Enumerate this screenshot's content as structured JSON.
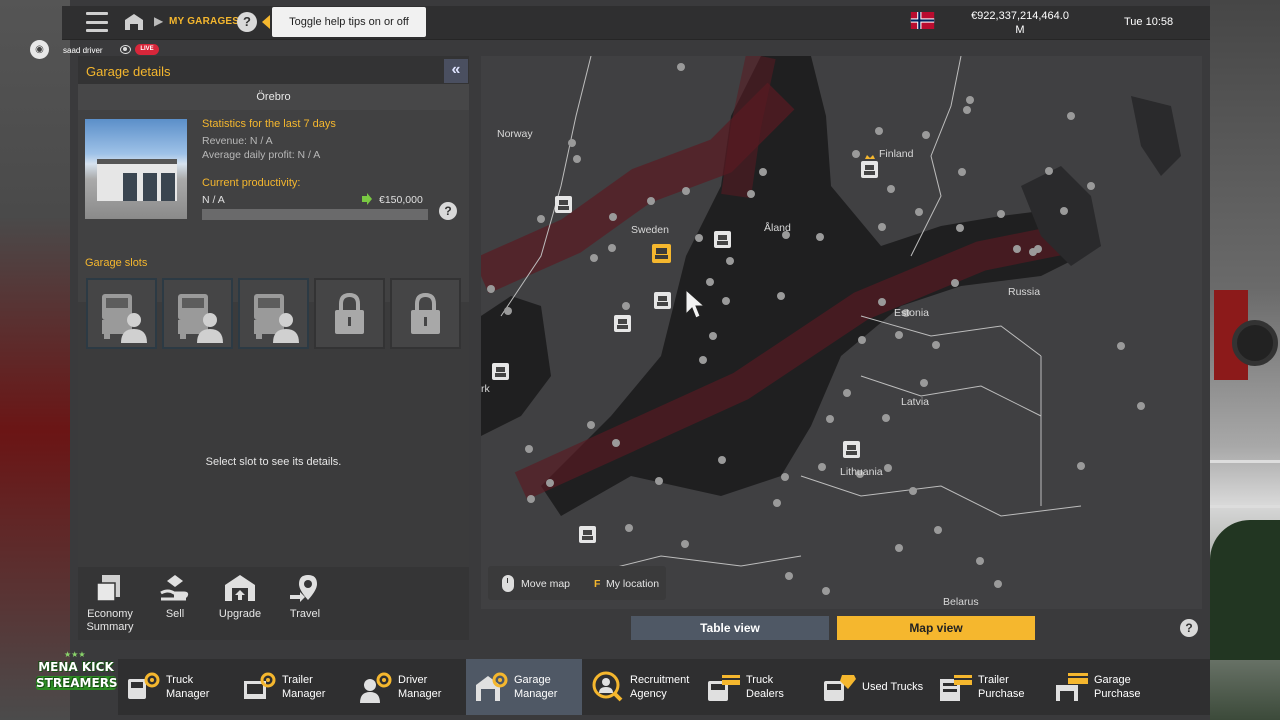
{
  "topbar": {
    "breadcrumb": "MY GARAGES",
    "help_glyph": "?",
    "tooltip": "Toggle help tips on or off",
    "money_line1": "€922,337,214,464.0",
    "money_line2": "M",
    "time": "Tue 10:58",
    "flag": "norway-flag"
  },
  "stream": {
    "user": "saad driver",
    "live": "LIVE"
  },
  "panel": {
    "title": "Garage details",
    "collapse_glyph": "«",
    "city": "Örebro",
    "stats_title": "Statistics for the last 7 days",
    "revenue": "Revenue: N / A",
    "avg_profit": "Average daily profit: N / A",
    "productivity_title": "Current productivity:",
    "productivity_value": "N / A",
    "upgrade_cost": "€150,000",
    "productivity_fraction": 0,
    "slots_title": "Garage slots",
    "slots": [
      {
        "state": "driver-slot"
      },
      {
        "state": "driver-slot"
      },
      {
        "state": "driver-slot"
      },
      {
        "state": "locked"
      },
      {
        "state": "locked"
      }
    ],
    "empty_message": "Select slot to see its details.",
    "actions": [
      {
        "label": "Economy\nSummary",
        "icon": "economy-icon"
      },
      {
        "label": "Sell",
        "icon": "sell-icon"
      },
      {
        "label": "Upgrade",
        "icon": "upgrade-icon"
      },
      {
        "label": "Travel",
        "icon": "travel-icon"
      }
    ]
  },
  "map": {
    "labels": {
      "norway": "Norway",
      "sweden": "Sweden",
      "aland": "Åland",
      "finland": "Finland",
      "russia": "Russia",
      "estonia": "Estonia",
      "latvia": "Latvia",
      "lithuania": "Lithuania",
      "belarus": "Belarus",
      "denmark_partial": "rk"
    },
    "controls": {
      "move": "Move map",
      "key": "F",
      "location": "My location"
    }
  },
  "views": {
    "table": "Table view",
    "map": "Map view",
    "help_glyph": "?"
  },
  "nav": [
    {
      "label": "Truck\nManager",
      "icon": "truck-manager-icon"
    },
    {
      "label": "Trailer\nManager",
      "icon": "trailer-manager-icon"
    },
    {
      "label": "Driver\nManager",
      "icon": "driver-manager-icon"
    },
    {
      "label": "Garage\nManager",
      "icon": "garage-manager-icon",
      "active": true
    },
    {
      "label": "Recruitment\nAgency",
      "icon": "recruitment-icon"
    },
    {
      "label": "Truck\nDealers",
      "icon": "truck-dealers-icon"
    },
    {
      "label": "Used Trucks",
      "icon": "used-trucks-icon"
    },
    {
      "label": "Trailer\nPurchase",
      "icon": "trailer-purchase-icon"
    },
    {
      "label": "Garage\nPurchase",
      "icon": "garage-purchase-icon"
    }
  ],
  "logo": {
    "line1": "MENA KICK",
    "line2": "STREAMERS",
    "stars": "★★★"
  },
  "colors": {
    "accent": "#f5b72e",
    "active_tab": "#4f5865",
    "panel": "#3b3b3c",
    "live": "#d8263a"
  }
}
